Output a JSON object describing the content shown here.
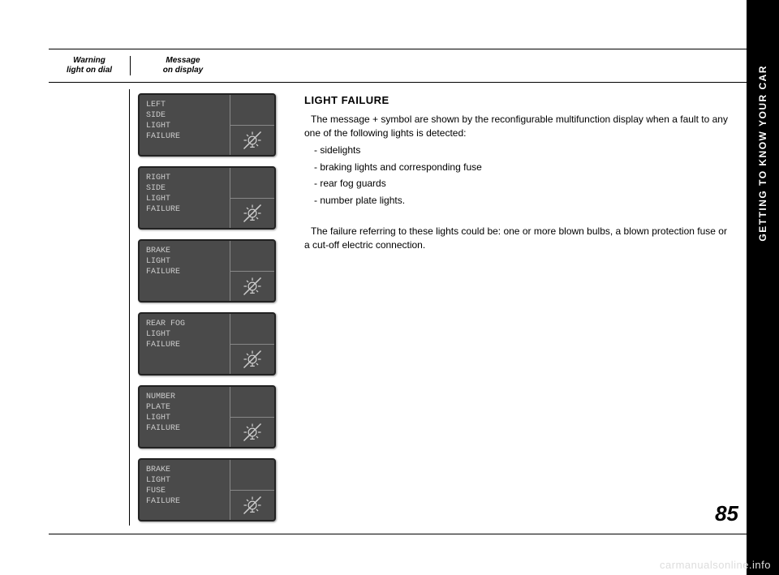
{
  "side_tab": "GETTING TO KNOW YOUR CAR",
  "page_number": "85",
  "header": {
    "col1": "Warning\nlight on dial",
    "col2": "Message\non display"
  },
  "displays": [
    {
      "text": "LEFT\nSIDE\nLIGHT\nFAILURE"
    },
    {
      "text": "RIGHT\nSIDE\nLIGHT\nFAILURE"
    },
    {
      "text": "BRAKE\nLIGHT\nFAILURE"
    },
    {
      "text": "REAR FOG\nLIGHT\nFAILURE"
    },
    {
      "text": "NUMBER\nPLATE\nLIGHT\nFAILURE"
    },
    {
      "text": "BRAKE\nLIGHT\nFUSE\nFAILURE"
    }
  ],
  "body": {
    "title": "LIGHT FAILURE",
    "intro": "The message + symbol are shown by the reconfigurable multifunction display when a fault to any one of the following lights is detected:",
    "bullets": [
      "- sidelights",
      "- braking lights and corresponding fuse",
      "- rear fog guards",
      "- number plate lights."
    ],
    "outro": "The failure referring to these lights could be: one or more blown bulbs, a blown protection fuse or a cut-off electric connection."
  },
  "watermark": "carmanualsonline.info"
}
